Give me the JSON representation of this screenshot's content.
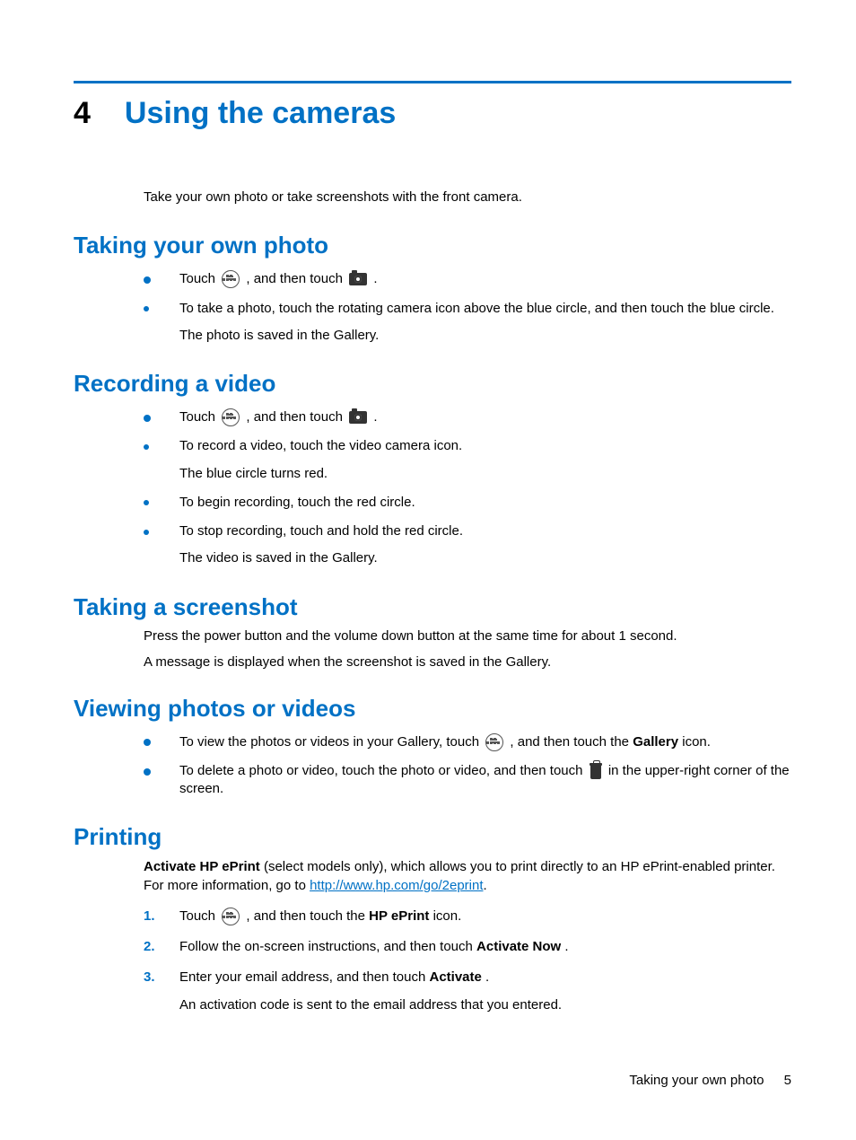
{
  "chapter": {
    "number": "4",
    "title": "Using the cameras"
  },
  "intro": "Take your own photo or take screenshots with the front camera.",
  "sections": {
    "photo": {
      "heading": "Taking your own photo",
      "b1a": "Touch ",
      "b1b": ", and then touch ",
      "b1c": ".",
      "b2": "To take a photo, touch the rotating camera icon above the blue circle, and then touch the blue circle.",
      "b2_note": "The photo is saved in the Gallery."
    },
    "video": {
      "heading": "Recording a video",
      "b1a": "Touch ",
      "b1b": ", and then touch ",
      "b1c": ".",
      "b2": "To record a video, touch the video camera icon.",
      "b2_note": "The blue circle turns red.",
      "b3": "To begin recording, touch the red circle.",
      "b4": "To stop recording, touch and hold the red circle.",
      "b4_note": "The video is saved in the Gallery."
    },
    "screenshot": {
      "heading": "Taking a screenshot",
      "p1": "Press the power button and the volume down button at the same time for about 1 second.",
      "p2": "A message is displayed when the screenshot is saved in the Gallery."
    },
    "viewing": {
      "heading": "Viewing photos or videos",
      "b1a": "To view the photos or videos in your Gallery, touch ",
      "b1b": ", and then touch the ",
      "b1_bold": "Gallery",
      "b1c": " icon.",
      "b2a": "To delete a photo or video, touch the photo or video, and then touch ",
      "b2b": " in the upper-right corner of the screen."
    },
    "printing": {
      "heading": "Printing",
      "p_bold": "Activate HP ePrint",
      "p_rest1": " (select models only), which allows you to print directly to an HP ePrint-enabled printer. For more information, go to ",
      "link": "http://www.hp.com/go/2eprint",
      "p_rest2": ".",
      "n1a": "Touch ",
      "n1b": ", and then touch the ",
      "n1_bold": "HP ePrint",
      "n1c": " icon.",
      "n2a": "Follow the on-screen instructions, and then touch ",
      "n2_bold": "Activate Now",
      "n2b": ".",
      "n3a": "Enter your email address, and then touch ",
      "n3_bold": "Activate",
      "n3b": ".",
      "n3_note": "An activation code is sent to the email address that you entered."
    }
  },
  "footer": {
    "text": "Taking your own photo",
    "page": "5"
  }
}
